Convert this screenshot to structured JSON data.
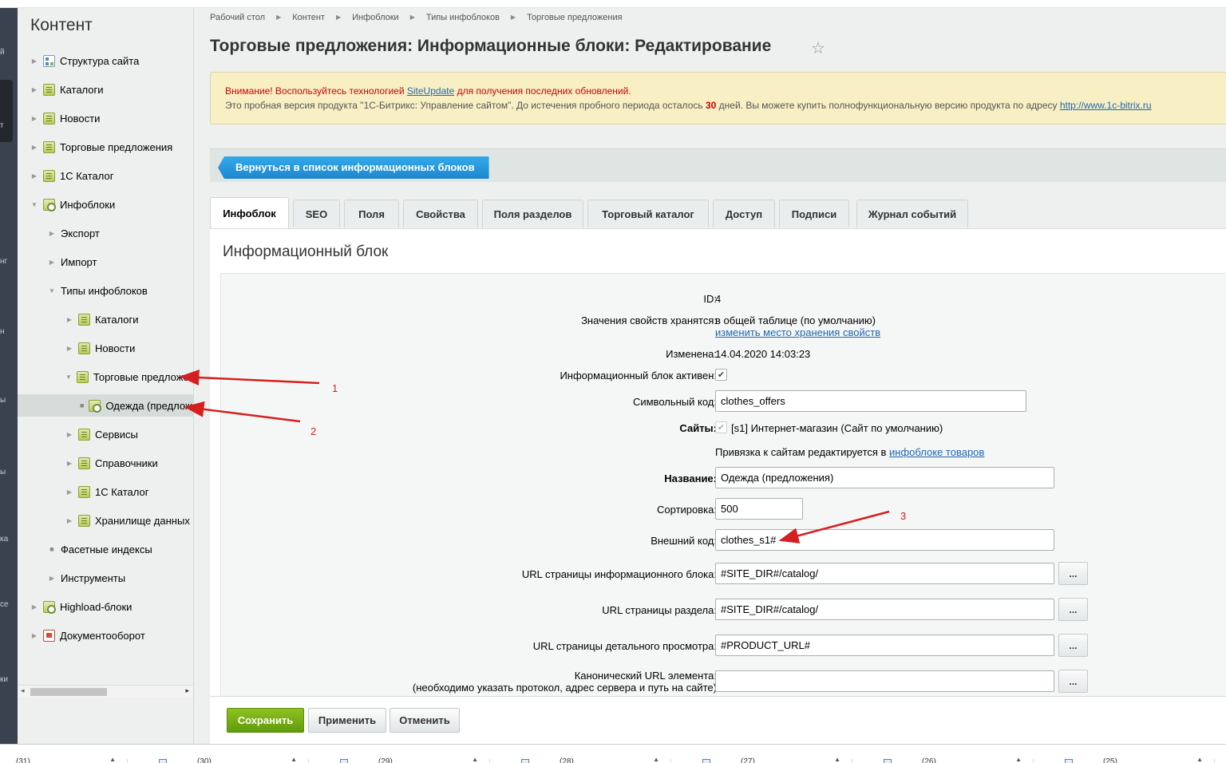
{
  "left_rail": {
    "fragments": [
      "й",
      "т",
      "нг",
      "н",
      "ы",
      "ы",
      "ка",
      "се",
      "ки"
    ]
  },
  "sidebar": {
    "title": "Контент",
    "items": [
      {
        "label": "Структура сайта",
        "level": 0,
        "marker": "collapsed",
        "icon": "structure-icon"
      },
      {
        "label": "Каталоги",
        "level": 0,
        "marker": "collapsed",
        "icon": "folder-icon"
      },
      {
        "label": "Новости",
        "level": 0,
        "marker": "collapsed",
        "icon": "folder-icon"
      },
      {
        "label": "Торговые предложения",
        "level": 0,
        "marker": "collapsed",
        "icon": "folder-icon"
      },
      {
        "label": "1С Каталог",
        "level": 0,
        "marker": "collapsed",
        "icon": "folder-icon"
      },
      {
        "label": "Инфоблоки",
        "level": 0,
        "marker": "expanded",
        "icon": "gear-folder-icon"
      },
      {
        "label": "Экспорт",
        "level": 1,
        "marker": "collapsed",
        "icon": ""
      },
      {
        "label": "Импорт",
        "level": 1,
        "marker": "collapsed",
        "icon": ""
      },
      {
        "label": "Типы инфоблоков",
        "level": 1,
        "marker": "expanded",
        "icon": ""
      },
      {
        "label": "Каталоги",
        "level": 2,
        "marker": "collapsed",
        "icon": "folder-icon"
      },
      {
        "label": "Новости",
        "level": 2,
        "marker": "collapsed",
        "icon": "folder-icon"
      },
      {
        "label": "Торговые предложения",
        "level": 2,
        "marker": "expanded",
        "icon": "folder-icon"
      },
      {
        "label": "Одежда (предложения)",
        "level": 3,
        "marker": "bullet",
        "icon": "gear-folder-icon",
        "selected": true
      },
      {
        "label": "Сервисы",
        "level": 2,
        "marker": "collapsed",
        "icon": "folder-icon"
      },
      {
        "label": "Справочники",
        "level": 2,
        "marker": "collapsed",
        "icon": "folder-icon"
      },
      {
        "label": "1С Каталог",
        "level": 2,
        "marker": "collapsed",
        "icon": "folder-icon"
      },
      {
        "label": "Хранилище данных",
        "level": 2,
        "marker": "collapsed",
        "icon": "folder-icon"
      },
      {
        "label": "Фасетные индексы",
        "level": 1,
        "marker": "bullet",
        "icon": ""
      },
      {
        "label": "Инструменты",
        "level": 1,
        "marker": "collapsed",
        "icon": ""
      },
      {
        "label": "Highload-блоки",
        "level": 0,
        "marker": "collapsed",
        "icon": "gear-folder-icon"
      },
      {
        "label": "Документооборот",
        "level": 0,
        "marker": "collapsed",
        "icon": "document-icon"
      }
    ]
  },
  "breadcrumb": [
    "Рабочий стол",
    "Контент",
    "Инфоблоки",
    "Типы инфоблоков",
    "Торговые предложения"
  ],
  "page_title": "Торговые предложения: Информационные блоки: Редактирование",
  "notice": {
    "warn_prefix": "Внимание! Воспользуйтесь технологией ",
    "warn_link": "SiteUpdate",
    "warn_suffix": " для получения последних обновлений.",
    "trial_prefix": "Это пробная версия продукта \"1С-Битрикс: Управление сайтом\". До истечения пробного периода осталось ",
    "trial_days": "30",
    "trial_suffix": " дней. Вы можете купить полнофункциональную версию продукта по адресу ",
    "trial_link": "http://www.1c-bitrix.ru"
  },
  "toolbar": {
    "back_label": "Вернуться в список информационных блоков"
  },
  "tabs": [
    "Инфоблок",
    "SEO",
    "Поля",
    "Свойства",
    "Поля разделов",
    "Торговый каталог",
    "Доступ",
    "Подписи",
    "Журнал событий"
  ],
  "panel": {
    "title": "Информационный блок",
    "id_label": "ID:",
    "id_value": "4",
    "storage_label": "Значения свойств хранятся:",
    "storage_value": "в общей таблице (по умолчанию)",
    "storage_link": "изменить место хранения свойств",
    "modified_label": "Изменена:",
    "modified_value": "14.04.2020 14:03:23",
    "active_label": "Информационный блок активен:",
    "code_label": "Символьный код:",
    "code_value": "clothes_offers",
    "sites_label": "Сайты:",
    "sites_value": "[s1] Интернет-магазин (Сайт по умолчанию)",
    "binding_text": "Привязка к сайтам редактируется в ",
    "binding_link": "инфоблоке товаров",
    "name_label": "Название:",
    "name_value": "Одежда (предложения)",
    "sort_label": "Сортировка:",
    "sort_value": "500",
    "xml_label": "Внешний код:",
    "xml_value": "clothes_s1#",
    "list_url_label": "URL страницы информационного блока:",
    "list_url_value": "#SITE_DIR#/catalog/",
    "section_url_label": "URL страницы раздела:",
    "section_url_value": "#SITE_DIR#/catalog/",
    "detail_url_label": "URL страницы детального просмотра:",
    "detail_url_value": "#PRODUCT_URL#",
    "canonical_label": "Канонический URL элемента:",
    "canonical_hint": "(необходимо указать протокол, адрес сервера и путь на сайте)",
    "canonical_value": "",
    "dots": "..."
  },
  "footer": {
    "save_label": "Сохранить",
    "apply_label": "Применить",
    "cancel_label": "Отменить"
  },
  "annotations": [
    "1",
    "2",
    "3"
  ],
  "taskbar": [
    "(31)",
    "(30)",
    "(29)",
    "(28)",
    "(27)",
    "(26)",
    "(25)"
  ],
  "colors": {
    "accent_blue": "#1e86cf",
    "save_green": "#6aa611",
    "warning_red": "#cc0000",
    "annotation_red": "#d42020"
  }
}
